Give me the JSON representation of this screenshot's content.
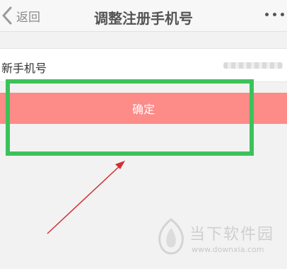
{
  "nav": {
    "back_label": "返回",
    "title": "调整注册手机号"
  },
  "form": {
    "phone_label": "新手机号",
    "phone_value": ""
  },
  "confirm_button": {
    "label": "确定"
  },
  "watermark": {
    "name": "当下软件园",
    "url": "www.downxia.com"
  },
  "colors": {
    "button_bg": "#fd8b88",
    "highlight_border": "#3cc25a",
    "arrow": "#d32f2f"
  },
  "icons": {
    "back": "chevron-left-icon",
    "more": "more-dots-icon",
    "logo": "downxia-logo-icon"
  }
}
